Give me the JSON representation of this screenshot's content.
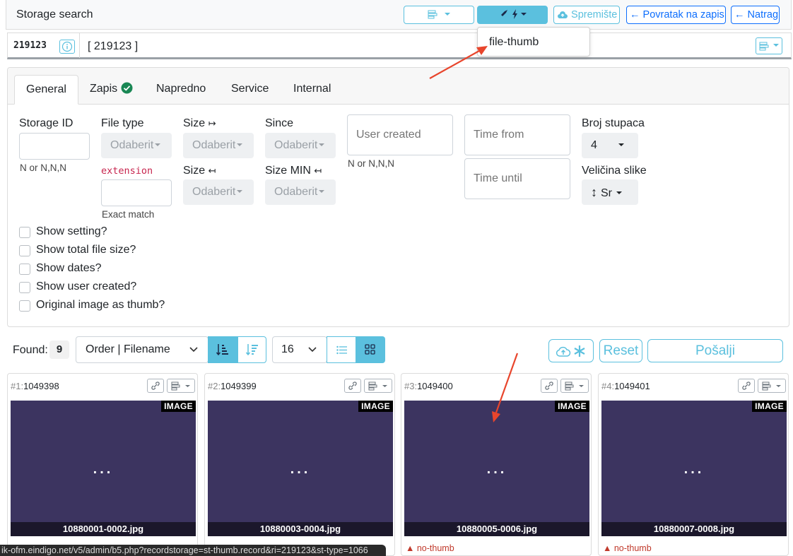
{
  "header": {
    "title": "Storage search",
    "spremiste_label": "Spremište",
    "povratak_label": "Povratak na zapis",
    "natrag_label": "Natrag"
  },
  "dropdown": {
    "items": [
      "file-thumb"
    ]
  },
  "record": {
    "id": "219123",
    "text": "[ 219123 ]"
  },
  "tabs": [
    {
      "label": "General",
      "active": true
    },
    {
      "label": "Zapis",
      "check": true
    },
    {
      "label": "Napredno"
    },
    {
      "label": "Service"
    },
    {
      "label": "Internal"
    }
  ],
  "form": {
    "storage_id_label": "Storage ID",
    "storage_id_hint": "N or N,N,N",
    "file_type_label": "File type",
    "file_type_value": "Odaberit",
    "extension_label": "extension",
    "extension_hint": "Exact match",
    "size_from_label": "Size",
    "size_from_value": "Odaberit",
    "size_to_label": "Size",
    "size_to_value": "Odaberit",
    "since_label": "Since",
    "since_value": "Odaberit",
    "size_min_label": "Size MIN",
    "size_min_value": "Odaberit",
    "user_created_placeholder": "User created",
    "user_created_hint": "N or N,N,N",
    "time_from_placeholder": "Time from",
    "time_until_placeholder": "Time until",
    "columns_label": "Broj stupaca",
    "columns_value": "4",
    "image_size_label": "Veličina slike",
    "image_size_value": "Sr"
  },
  "checkboxes": [
    "Show setting?",
    "Show total file size?",
    "Show dates?",
    "Show user created?",
    "Original image as thumb?"
  ],
  "toolbar": {
    "found_label": "Found:",
    "found_count": "9",
    "order_value": "Order | Filename",
    "per_page_value": "16",
    "reset_label": "Reset",
    "send_label": "Pošalji"
  },
  "results": [
    {
      "index": "#1:",
      "id": "1049398",
      "badge": "IMAGE",
      "dots": "...",
      "filename": "10880001-0002.jpg",
      "status": ""
    },
    {
      "index": "#2:",
      "id": "1049399",
      "badge": "IMAGE",
      "dots": "...",
      "filename": "10880003-0004.jpg",
      "status": ""
    },
    {
      "index": "#3:",
      "id": "1049400",
      "badge": "IMAGE",
      "dots": "...",
      "filename": "10880005-0006.jpg",
      "status": "no-thumb"
    },
    {
      "index": "#4:",
      "id": "1049401",
      "badge": "IMAGE",
      "dots": "...",
      "filename": "10880007-0008.jpg",
      "status": "no-thumb"
    }
  ],
  "status_bar": {
    "url": "ik-ofm.eindigo.net/v5/admin/b5.php?recordstorage=st-thumb.record&ri=219123&st-type=1066"
  },
  "colors": {
    "info": "#5bc0de",
    "primary": "#0d6efd",
    "thumb_bg": "#3c3460",
    "annotation_arrow": "#e8452c"
  }
}
